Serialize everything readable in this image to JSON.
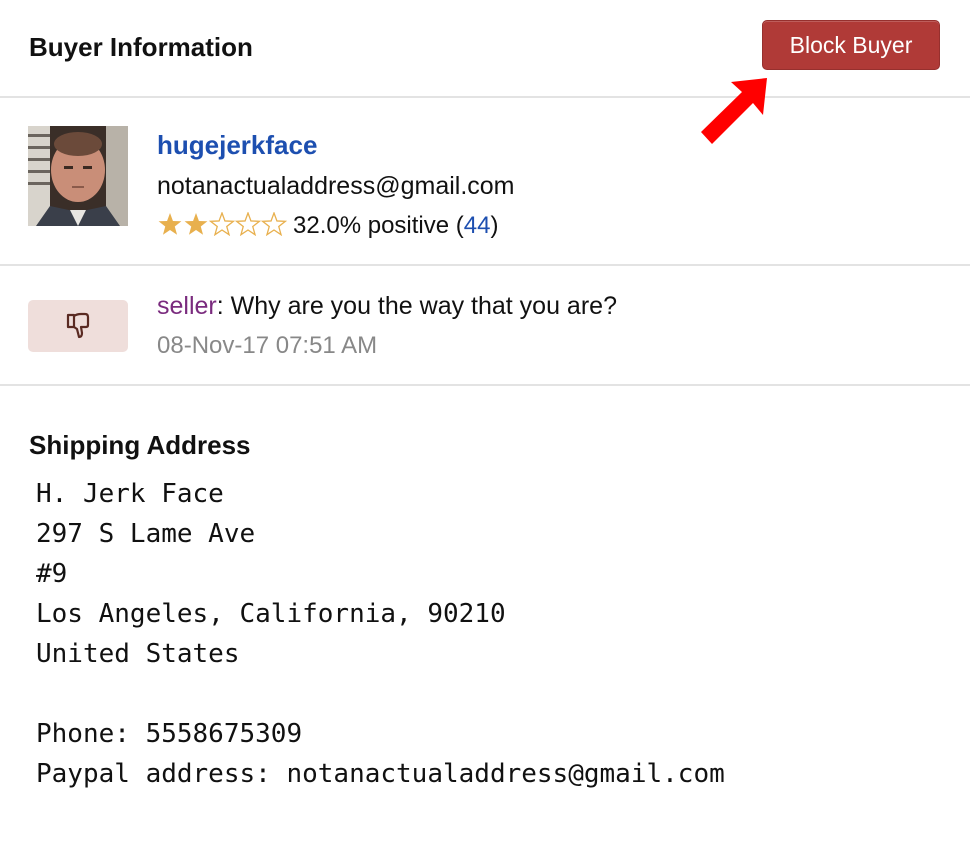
{
  "header": {
    "title": "Buyer Information",
    "block_button_label": "Block Buyer"
  },
  "buyer": {
    "username": "hugejerkface",
    "email": "notanactualaddress@gmail.com",
    "stars_filled": 2,
    "stars_total": 5,
    "positive_text": "32.0% positive (",
    "feedback_count": "44",
    "close_paren": ")"
  },
  "feedback": {
    "type_icon": "thumbs-down-icon",
    "author": "seller",
    "separator": ": ",
    "message": "Why are you the way that you are?",
    "date": "08-Nov-17 07:51 AM"
  },
  "shipping": {
    "title": "Shipping Address",
    "name": "H. Jerk Face",
    "street": "297 S Lame Ave",
    "unit": "#9",
    "city_line": "Los Angeles, California, 90210",
    "country": "United States",
    "phone_line": "Phone: 5558675309",
    "paypal_line": "Paypal address: notanactualaddress@gmail.com"
  },
  "colors": {
    "block_button": "#b03a37",
    "link_blue": "#1d4fb0",
    "author_purple": "#7a2b7e",
    "star_gold": "#e8b04e",
    "badge_bg": "#efdedb",
    "arrow_red": "#ff0000"
  }
}
